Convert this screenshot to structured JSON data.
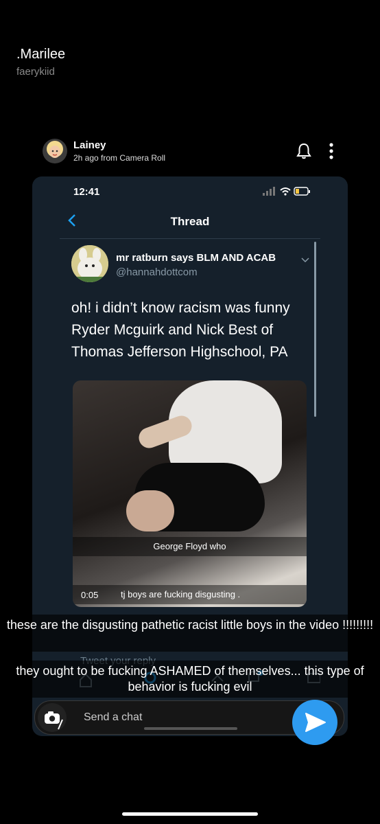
{
  "story": {
    "user_name": ".Marilee",
    "user_handle": "faerykiid"
  },
  "post": {
    "poster_name": "Lainey",
    "poster_meta": "2h ago from Camera Roll",
    "bell_icon": "bell-icon",
    "more_icon": "more-vertical-icon"
  },
  "screenshot": {
    "status_time": "12:41",
    "nav_title": "Thread",
    "tweet": {
      "author": "mr ratburn says BLM AND ACAB",
      "handle": "@hannahdottcom",
      "text": "oh! i didn’t know racism was funny Ryder Mcguirk and Nick Best of Thomas Jefferson Highschool, PA"
    },
    "video": {
      "caption_top": "George Floyd who",
      "duration": "0:05",
      "caption_bottom": "tj boys are fucking disgusting ."
    },
    "reply_placeholder": "Tweet your reply"
  },
  "overlay": {
    "caption_1": "these are the disgusting pathetic racist little boys in the video !!!!!!!!!",
    "caption_2": "they ought to be fucking ASHAMED of themselves... this type of behavior is fucking evil"
  },
  "chat": {
    "placeholder": "Send a chat",
    "camera_icon": "camera-icon",
    "send_icon": "send-arrow-icon",
    "accent": "#2e9bf0"
  }
}
